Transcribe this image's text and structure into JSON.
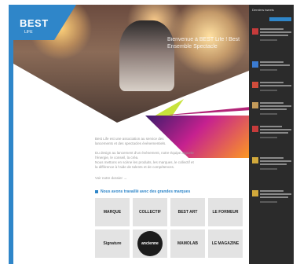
{
  "logo": {
    "name": "BEST",
    "subtitle": "LIFE"
  },
  "hero": {
    "title": "Bienvenue à BEST Life ! Best Ensemble Spectacle"
  },
  "intro": {
    "lines": [
      "Best Life est une association au service des",
      "lancements et des spectacles événementiels.",
      "",
      "Du design au lancement d'un événement, notre équipe apporte",
      "l'énergie, le conseil, la créa.",
      "Nous mettons en scène les produits, les marques, le collectif et",
      "la différence à l'aide de talents et de compétences.",
      "",
      "Voir notre dossier →"
    ]
  },
  "section_title": "Nous avons travaillé avec des grandes marques",
  "clients": [
    {
      "label": "MARQUE"
    },
    {
      "label": "COLLECTIF"
    },
    {
      "label": "BEST ART"
    },
    {
      "label": "LE FORMEUR"
    },
    {
      "label": "Signature"
    },
    {
      "label": "ancienne"
    },
    {
      "label": "MAMOLAB"
    },
    {
      "label": "LE MAGAZINE"
    }
  ],
  "sidebar": {
    "header": "Derniers tweets",
    "follow_label": "Suivre",
    "posts": [
      {
        "color": "#c63b3b"
      },
      {
        "color": "#3b7bd1"
      },
      {
        "color": "#d14c3b"
      },
      {
        "color": "#c49b5a"
      },
      {
        "color": "#c63b3b"
      },
      {
        "color": "#d1a83b"
      },
      {
        "color": "#d1a83b"
      }
    ]
  }
}
